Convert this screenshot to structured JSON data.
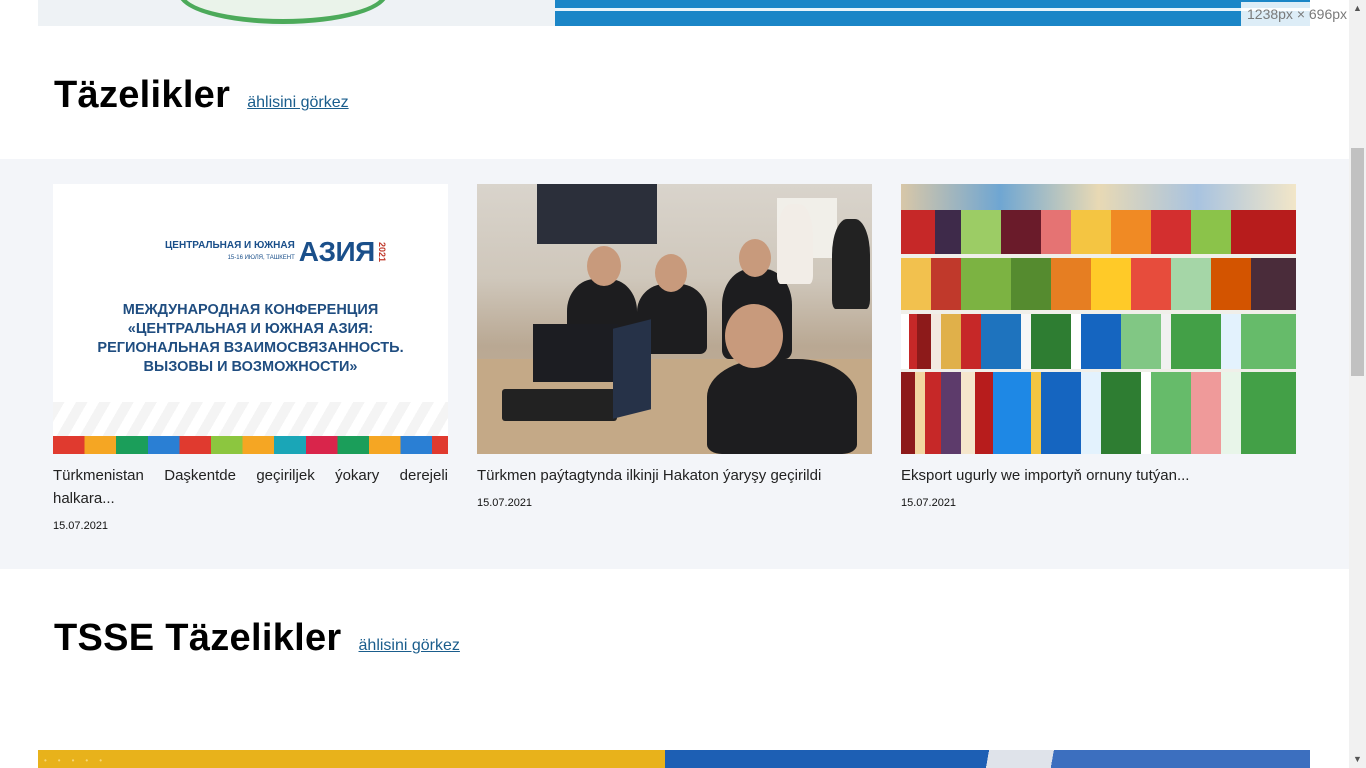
{
  "dimension_badge": "1238px × 696px",
  "sections": [
    {
      "title": "Täzelikler",
      "link": "ählisini görkez"
    },
    {
      "title": "TSSE Täzelikler",
      "link": "ählisini görkez"
    }
  ],
  "cards": [
    {
      "image": {
        "logo_small": "ЦЕНТРАЛЬНАЯ И ЮЖНАЯ",
        "logo_big": "АЗИЯ",
        "logo_year": "2021",
        "logo_sub": "15-16 ИЮЛЯ, ТАШКЕНТ",
        "headline_lines": [
          "МЕЖДУНАРОДНАЯ КОНФЕРЕНЦИЯ",
          "«ЦЕНТРАЛЬНАЯ И ЮЖНАЯ АЗИЯ:",
          "РЕГИОНАЛЬНАЯ ВЗАИМОСВЯЗАННОСТЬ.",
          "ВЫЗОВЫ И ВОЗМОЖНОСТИ»"
        ]
      },
      "title": "Türkmenistan Daşkentde geçiriljek ýokary derejeli halkara...",
      "date": "15.07.2021"
    },
    {
      "title": "Türkmen paýtagtynda ilkinji Hakaton ýaryşy geçirildi",
      "date": "15.07.2021"
    },
    {
      "title": "Eksport ugurly we importyň ornuny tutýan...",
      "date": "15.07.2021"
    }
  ],
  "scrollbar": {
    "up_glyph": "▲",
    "down_glyph": "▼"
  }
}
